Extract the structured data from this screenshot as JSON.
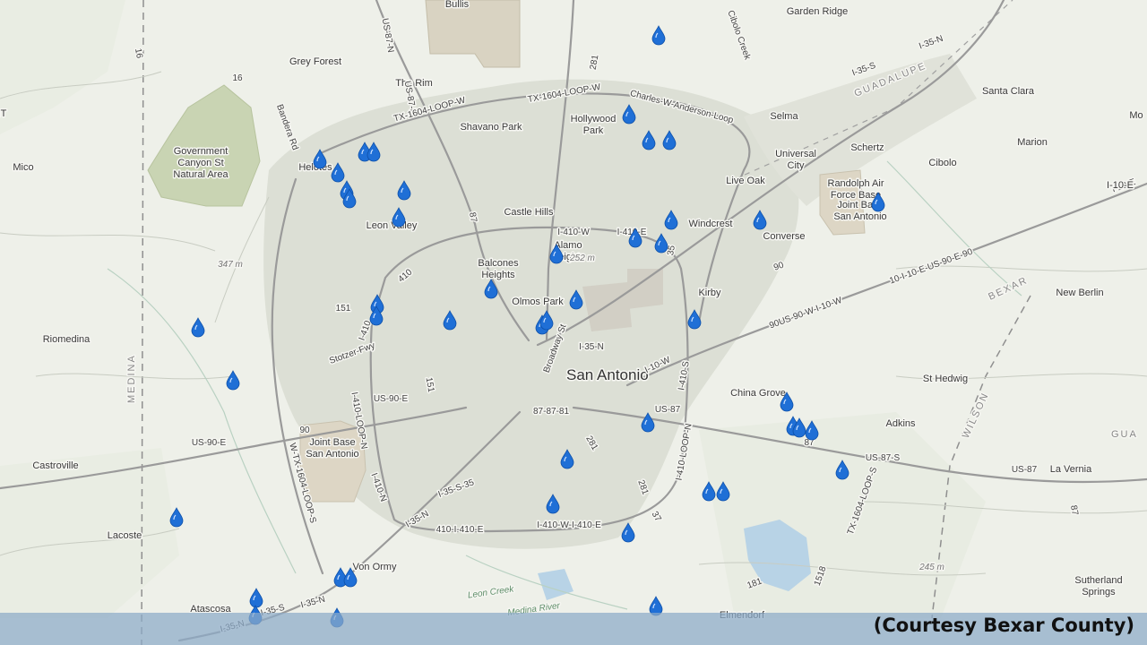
{
  "map": {
    "credit": "(Courtesy Bexar County)",
    "marker_icon": "water-drop-icon",
    "marker_color": "#1f6fd6",
    "labels": {
      "city": [
        {
          "text": "Bullis"
        },
        {
          "text": "Garden Ridge"
        },
        {
          "text": "Grey Forest"
        },
        {
          "text": "The Rim"
        },
        {
          "text": "Shavano Park"
        },
        {
          "text": "Hollywood Park"
        },
        {
          "text": "Selma"
        },
        {
          "text": "Universal City"
        },
        {
          "text": "Schertz"
        },
        {
          "text": "Cibolo"
        },
        {
          "text": "Marion"
        },
        {
          "text": "Santa Clara"
        },
        {
          "text": "Mico"
        },
        {
          "text": "Government Canyon St Natural Area"
        },
        {
          "text": "Helotes"
        },
        {
          "text": "Live Oak"
        },
        {
          "text": "Randolph Air Force Base"
        },
        {
          "text": "Joint Base San Antonio"
        },
        {
          "text": "Castle Hills"
        },
        {
          "text": "Windcrest"
        },
        {
          "text": "Converse"
        },
        {
          "text": "Leon Valley"
        },
        {
          "text": "Balcones Heights"
        },
        {
          "text": "Alamo Heights"
        },
        {
          "text": "Olmos Park"
        },
        {
          "text": "Kirby"
        },
        {
          "text": "New Berlin"
        },
        {
          "text": "Riomedina"
        },
        {
          "text": "St Hedwig"
        },
        {
          "text": "China Grove"
        },
        {
          "text": "Adkins"
        },
        {
          "text": "Castroville"
        },
        {
          "text": "Joint Base San Antonio"
        },
        {
          "text": "La Vernia"
        },
        {
          "text": "Lacoste"
        },
        {
          "text": "Von Ormy"
        },
        {
          "text": "Atascosa"
        },
        {
          "text": "Elmendorf"
        },
        {
          "text": "Sutherland Springs"
        }
      ],
      "major": [
        {
          "text": "San Antonio"
        }
      ],
      "county": [
        {
          "text": "MEDINA"
        },
        {
          "text": "BEXAR"
        },
        {
          "text": "WILSON"
        },
        {
          "text": "GUADALUPE"
        },
        {
          "text": "GUA"
        }
      ],
      "roads": [
        {
          "text": "US-87-N"
        },
        {
          "text": "US-87-N"
        },
        {
          "text": "TX-1604-LOOP-W"
        },
        {
          "text": "TX-1604-LOOP-W"
        },
        {
          "text": "Charles-W-Anderson-Loop"
        },
        {
          "text": "281"
        },
        {
          "text": "I-35-N"
        },
        {
          "text": "I-35-S"
        },
        {
          "text": "I-10-E"
        },
        {
          "text": "87"
        },
        {
          "text": "I-410-W"
        },
        {
          "text": "I-410-E"
        },
        {
          "text": "35"
        },
        {
          "text": "410"
        },
        {
          "text": "I-410"
        },
        {
          "text": "Broadway St"
        },
        {
          "text": "I-35-N"
        },
        {
          "text": "90US-90-W-I-10-W"
        },
        {
          "text": "10-I-10-E-US-90-E-90"
        },
        {
          "text": "90"
        },
        {
          "text": "I-10-W"
        },
        {
          "text": "I-410-S"
        },
        {
          "text": "US-90-E"
        },
        {
          "text": "87-87-81"
        },
        {
          "text": "US-90-E"
        },
        {
          "text": "90"
        },
        {
          "text": "US-87"
        },
        {
          "text": "87"
        },
        {
          "text": "US-87-S"
        },
        {
          "text": "US-87"
        },
        {
          "text": "87"
        },
        {
          "text": "I-410-LOOP-N"
        },
        {
          "text": "281"
        },
        {
          "text": "I-410-LOOP-N"
        },
        {
          "text": "I-410-N"
        },
        {
          "text": "I-35-S-35"
        },
        {
          "text": "281"
        },
        {
          "text": "37"
        },
        {
          "text": "I-35-N"
        },
        {
          "text": "410-I-410-E"
        },
        {
          "text": "I-410-W-I-410-E"
        },
        {
          "text": "W-TX-1604-LOOP-S"
        },
        {
          "text": "I-35-S"
        },
        {
          "text": "I-35-N"
        },
        {
          "text": "I-35-N"
        },
        {
          "text": "TX-1604-LOOP-S"
        },
        {
          "text": "1518"
        },
        {
          "text": "181"
        },
        {
          "text": "Bandera Rd"
        },
        {
          "text": "16"
        },
        {
          "text": "16"
        },
        {
          "text": "151"
        },
        {
          "text": "151"
        },
        {
          "text": "Stotzer-Fwy"
        },
        {
          "text": "Cibolo Creek"
        }
      ],
      "elevation": [
        {
          "text": "347 m"
        },
        {
          "text": "252 m"
        },
        {
          "text": "245 m"
        }
      ],
      "water": [
        {
          "text": "Leon Creek"
        },
        {
          "text": "Medina River"
        }
      ],
      "edge": [
        {
          "text": "NT"
        },
        {
          "text": "I-10-E"
        },
        {
          "text": "Mo"
        }
      ]
    }
  }
}
